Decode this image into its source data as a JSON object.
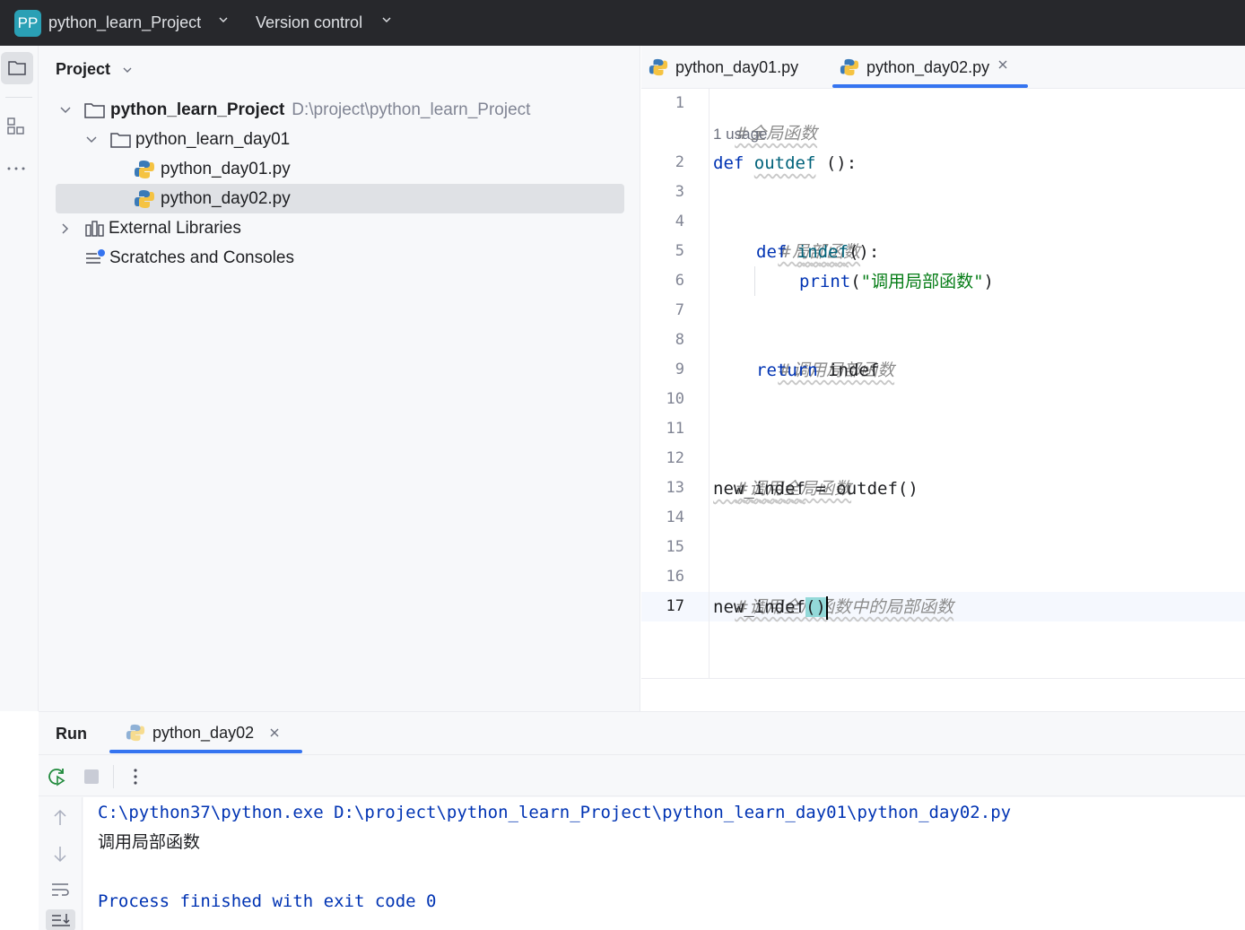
{
  "titlebar": {
    "project_badge": "PP",
    "project_name": "python_learn_Project",
    "vcs_label": "Version control"
  },
  "project_panel": {
    "title": "Project",
    "tree": {
      "root_name": "python_learn_Project",
      "root_path": "D:\\project\\python_learn_Project",
      "folder": "python_learn_day01",
      "file1": "python_day01.py",
      "file2": "python_day02.py",
      "external": "External Libraries",
      "scratches": "Scratches and Consoles"
    }
  },
  "editor": {
    "tabs": {
      "tab1": "python_day01.py",
      "tab2": "python_day02.py"
    },
    "usage_hint": "1 usage",
    "line_numbers": [
      "1",
      "2",
      "3",
      "4",
      "5",
      "6",
      "7",
      "8",
      "9",
      "10",
      "11",
      "12",
      "13",
      "14",
      "15",
      "16",
      "17"
    ],
    "code": {
      "l1_comment": "#全局函数",
      "l2_def": "def",
      "l2_name": "outdef",
      "l2_rest": " ():",
      "l4_comment": "#局部函数",
      "l5_def": "def",
      "l5_name": "indef",
      "l5_rest": "():",
      "l6_print": "print",
      "l6_open": "(",
      "l6_str": "\"调用局部函数\"",
      "l6_close": ")",
      "l8_comment": "#调用局部函数",
      "l9_return": "return",
      "l9_rest": " indef",
      "l12_comment": "#调用全局函数",
      "l13_var": "new_indef",
      "l13_rest": " = outdef()",
      "l16_comment": "#调用全局函数中的局部函数",
      "l17_name": "new_indef",
      "l17_parens": "()"
    }
  },
  "run_panel": {
    "title": "Run",
    "tab_label": "python_day02",
    "console": {
      "command": "C:\\python37\\python.exe D:\\project\\python_learn_Project\\python_learn_day01\\python_day02.py",
      "output": "调用局部函数",
      "exit": "Process finished with exit code 0"
    }
  },
  "colors": {
    "accent": "#3574f0",
    "keyword": "#0033b3",
    "function": "#00627a",
    "string": "#067d17",
    "comment": "#8c8c8c",
    "titlebar_bg": "#27282c"
  }
}
